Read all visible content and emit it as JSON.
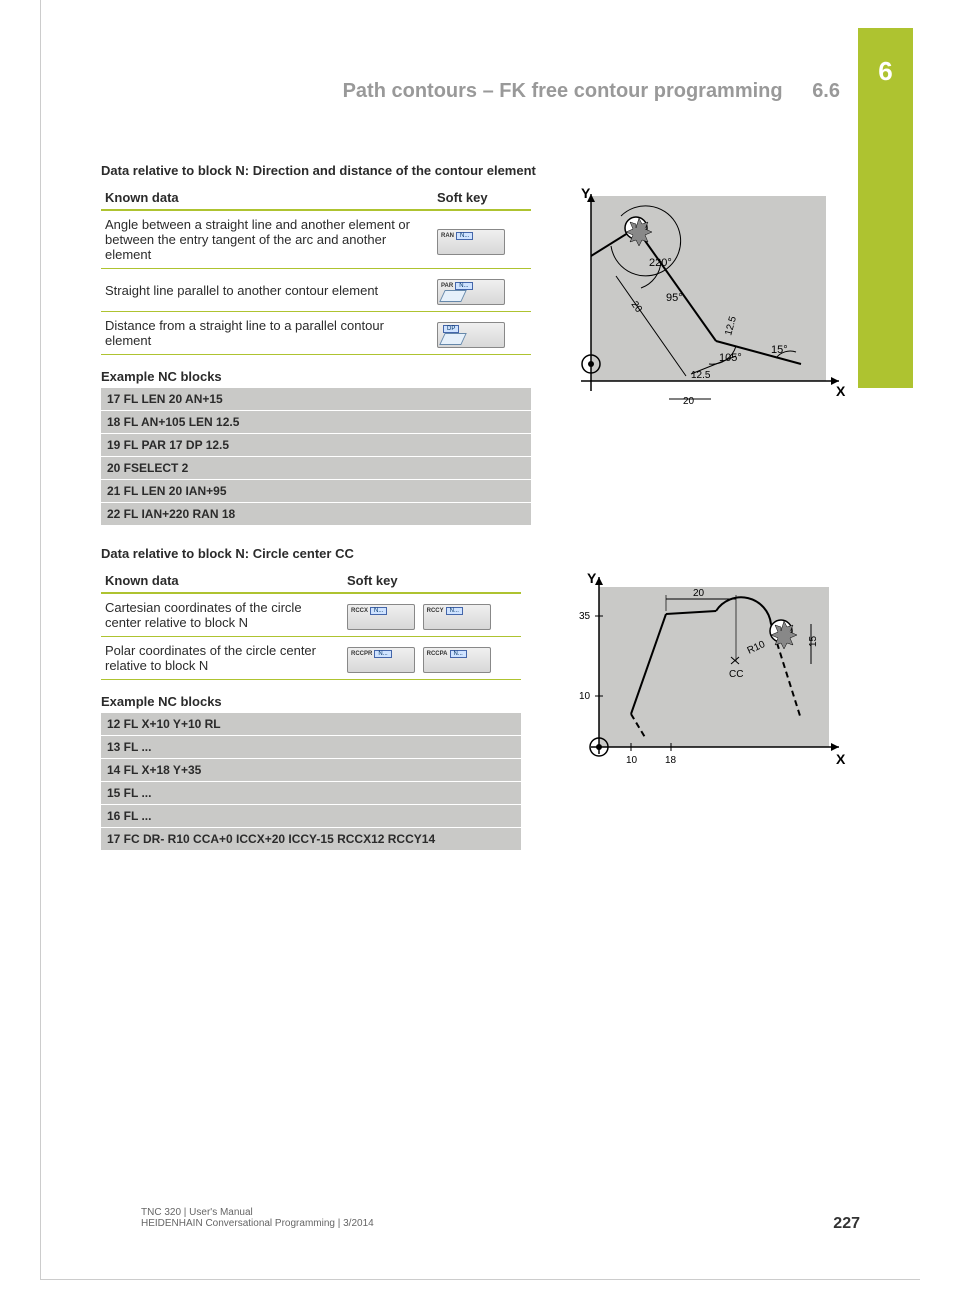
{
  "chapter_tab": "6",
  "header": {
    "title": "Path contours – FK free contour programming",
    "section": "6.6"
  },
  "section1": {
    "heading": "Data relative to block N: Direction and distance of the contour element",
    "th_known": "Known data",
    "th_softkey": "Soft key",
    "rows": [
      {
        "desc": "Angle between a straight line and another element or between the entry tangent of the arc and another element",
        "sk": [
          {
            "label": "RAN",
            "box": "N..."
          }
        ]
      },
      {
        "desc": "Straight line parallel to another contour element",
        "sk": [
          {
            "label": "PAR",
            "box": "N...",
            "shape": true
          }
        ]
      },
      {
        "desc": "Distance from a straight line to a parallel contour element",
        "sk": [
          {
            "label": "",
            "box": "DP",
            "shape": true
          }
        ]
      }
    ],
    "example_heading": "Example NC blocks",
    "nc": [
      "17 FL LEN 20 AN+15",
      "18 FL AN+105 LEN 12.5",
      "19 FL PAR 17 DP 12.5",
      "20 FSELECT 2",
      "21 FL LEN 20 IAN+95",
      "22 FL IAN+220 RAN 18"
    ]
  },
  "section2": {
    "heading": "Data relative to block N: Circle center CC",
    "th_known": "Known data",
    "th_softkey": "Soft key",
    "rows": [
      {
        "desc": "Cartesian coordinates of the circle center relative to block N",
        "sk": [
          {
            "label": "RCCX",
            "box": "N..."
          },
          {
            "label": "RCCY",
            "box": "N..."
          }
        ]
      },
      {
        "desc": "Polar coordinates of the circle center relative to block N",
        "sk": [
          {
            "label": "RCCPR",
            "box": "N..."
          },
          {
            "label": "RCCPA",
            "box": "N..."
          }
        ]
      }
    ],
    "example_heading": "Example NC blocks",
    "nc": [
      "12 FL X+10 Y+10 RL",
      "13 FL ...",
      "14 FL X+18 Y+35",
      "15 FL ...",
      "16 FL ...",
      "17 FC DR- R10 CCA+0 ICCX+20 ICCY-15 RCCX12 RCCY14"
    ]
  },
  "diagram1": {
    "axes": {
      "x": "X",
      "y": "Y"
    },
    "labels": {
      "a220": "220°",
      "a95": "95°",
      "a105": "105°",
      "a15": "15°",
      "d20a": "20",
      "d20b": "20",
      "d125a": "12.5",
      "d125b": "12.5"
    }
  },
  "diagram2": {
    "axes": {
      "x": "X",
      "y": "Y"
    },
    "labels": {
      "x10": "10",
      "x18": "18",
      "y10": "10",
      "y35": "35",
      "d20": "20",
      "d15": "15",
      "r10": "R10",
      "cc": "CC"
    }
  },
  "footer": {
    "line1": "TNC 320 | User's Manual",
    "line2": "HEIDENHAIN Conversational Programming | 3/2014"
  },
  "page_number": "227"
}
